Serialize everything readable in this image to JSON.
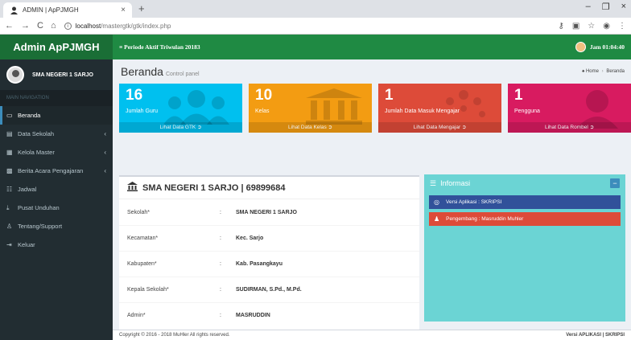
{
  "browser": {
    "tab_title": "ADMIN | ApPJMGH",
    "new_tab": "+",
    "url_host": "localhost",
    "url_path": "/mastergtk/gtk/index.php"
  },
  "app": {
    "logo": "Admin ApPJMGH",
    "period": "≡ Periode Aktif Triwulan 20183",
    "clock": "Jam 01:04:40"
  },
  "sidebar": {
    "user_name": "SMA NEGERI 1 SARJO",
    "nav_header": "MAIN NAVIGATION",
    "items": [
      {
        "label": "Beranda",
        "icon": "monitor-icon",
        "glyph": "▭"
      },
      {
        "label": "Data Sekolah",
        "icon": "building-icon",
        "glyph": "▤",
        "chev": "‹"
      },
      {
        "label": "Kelola Master",
        "icon": "file-icon",
        "glyph": "▦",
        "chev": "‹"
      },
      {
        "label": "Berita Acara Pengajaran",
        "icon": "newspaper-icon",
        "glyph": "▩",
        "chev": "‹"
      },
      {
        "label": "Jadwal",
        "icon": "table-icon",
        "glyph": "☷"
      },
      {
        "label": "Pusat Unduhan",
        "icon": "download-icon",
        "glyph": "⤓"
      },
      {
        "label": "Tentang/Support",
        "icon": "support-icon",
        "glyph": "♙"
      },
      {
        "label": "Keluar",
        "icon": "signout-icon",
        "glyph": "⇥"
      }
    ]
  },
  "page": {
    "title": "Beranda",
    "subtitle": "Control panel",
    "crumb_home": "Home",
    "crumb_current": "Beranda"
  },
  "boxes": [
    {
      "num": "16",
      "label": "Jumlah Guru",
      "link": "Lihat Data GTK ➲",
      "color": "#00c0ef"
    },
    {
      "num": "10",
      "label": "Kelas",
      "link": "Lihat Data Kelas ➲",
      "color": "#f39c12"
    },
    {
      "num": "1",
      "label": "Jumlah Data Masuk Mengajar",
      "link": "Lihat Data Mengajar ➲",
      "color": "#dd4b39"
    },
    {
      "num": "1",
      "label": "Pengguna",
      "link": "Lihat Data Rombel ➲",
      "color": "#d81b60"
    }
  ],
  "school": {
    "heading": "SMA NEGERI 1 SARJO | 69899684",
    "rows": [
      {
        "key": "Sekolah*",
        "value": "SMA NEGERI 1 SARJO"
      },
      {
        "key": "Kecamatan*",
        "value": "Kec. Sarjo"
      },
      {
        "key": "Kabupaten*",
        "value": "Kab. Pasangkayu"
      },
      {
        "key": "Kepala Sekolah*",
        "value": "SUDIRMAN, S.Pd., M.Pd."
      },
      {
        "key": "Admin*",
        "value": "MASRUDDIN"
      }
    ],
    "colon": ":"
  },
  "info": {
    "title": "Informasi",
    "collapse": "−",
    "version": "Versi Aplikasi : SKRIPSI",
    "developer": "Pengembang : Masruddin Muhler"
  },
  "footer": {
    "left": "Copyright © 2016 - 2018 MuHler All rights reserved.",
    "right": "Versi APLIKASI | SKRIPSI"
  }
}
